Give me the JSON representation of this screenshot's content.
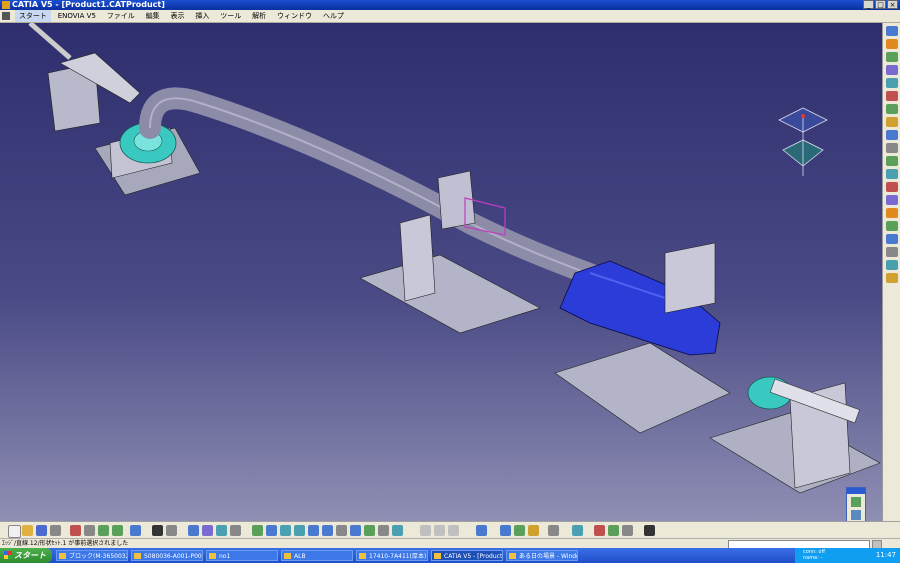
{
  "window": {
    "title": "CATIA V5 - [Product1.CATProduct]"
  },
  "menubar": {
    "items": [
      "スタート",
      "ENOVIA V5",
      "ファイル",
      "編集",
      "表示",
      "挿入",
      "ツール",
      "解析",
      "ウィンドウ",
      "ヘルプ"
    ]
  },
  "status": {
    "message": "ｴｯｼﾞ/直線.12/形状ｾｯﾄ.1 が事前選択されました"
  },
  "taskbar": {
    "start_label": "スタート",
    "tasks": [
      "ブロック(M-3650032-S...",
      "S080036-A001-P001",
      "no1",
      "ALB",
      "17410-7A411(厚本)",
      "CATIA V5 - [Product...",
      "ある日の場景 - Windo..."
    ],
    "tray_info_1": "conn: off",
    "tray_info_2": "name: -",
    "clock": "11:47"
  },
  "colors": {
    "viewport_top": "#2e2e6e",
    "viewport_bottom": "#8f8fb4",
    "catalyst": "#2b3cd8",
    "pipe": "#8c8ca8",
    "flange": "#39c9c0"
  }
}
